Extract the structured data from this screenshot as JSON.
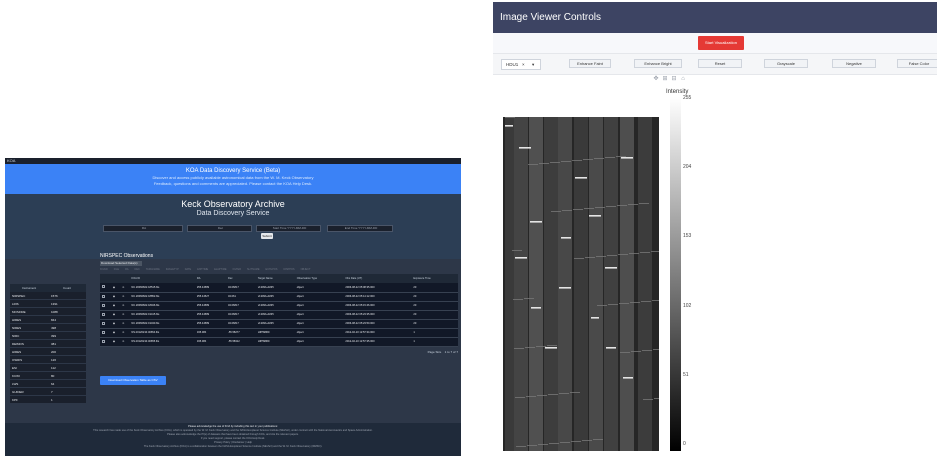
{
  "koa": {
    "topbar": "KOA",
    "banner": {
      "title": "KOA Data Discovery Service (Beta)",
      "line1": "Discover and access publicly available astronomical data from the W. M. Keck Observatory",
      "line2": "Feedback, questions and comments are appreciated. Please contact the KOA Help Desk."
    },
    "hero": {
      "title": "Keck Observatory Archive",
      "subtitle": "Data Discovery Service"
    },
    "inputs": [
      "RA",
      "Dec",
      "Start Time YYYY-MM-DD",
      "End Time YYYY-MM-DD"
    ],
    "submit": "Submit",
    "instruments": {
      "headers": [
        "Instrument",
        "Count"
      ],
      "rows": [
        [
          "NIRSPEC",
          "1576"
        ],
        [
          "LRIS",
          "1391"
        ],
        [
          "MOSFIRE",
          "1088"
        ],
        [
          "HIRES",
          "844"
        ],
        [
          "NIRES",
          "498"
        ],
        [
          "NIRC",
          "399"
        ],
        [
          "DEIMOS",
          "381"
        ],
        [
          "HIRES",
          "200"
        ],
        [
          "OSIRIS",
          "126"
        ],
        [
          "ESI",
          "112"
        ],
        [
          "KCWI",
          "80"
        ],
        [
          "LWS",
          "64"
        ],
        [
          "GUIDER",
          "7"
        ],
        [
          "KPF",
          "1"
        ]
      ]
    },
    "obs": {
      "title": "NIRSPEC Observations",
      "download_selected": "Download Selected Data(s)",
      "col_strip": [
        "KOAID",
        "FILE",
        "RA",
        "DEC",
        "TARGNAME",
        "IMAGETYP",
        "DATE",
        "EXPTIME",
        "ELAPTIME",
        "FILTER",
        "SLITNAME",
        "ECHLPOS",
        "DISPPOS",
        "OBJECT"
      ],
      "headers": [
        "",
        "",
        "",
        "KOA ID",
        "RA",
        "Dec",
        "Target Name",
        "Observation Type",
        "Obs Date (UT)",
        "Exposure Time",
        ""
      ],
      "rows": [
        [
          "",
          "",
          "",
          "NC.20060822.18515.fits",
          "255.44589",
          "43.06817",
          "v1309b+0235",
          "object",
          "2006-08-22 05:08:35.000",
          "20",
          ""
        ],
        [
          "",
          "",
          "",
          "NC.20060822.18852.fits",
          "255.44527",
          "43.061",
          "v1309b+0235",
          "object",
          "2006-08-22 05:14:12.000",
          "20",
          ""
        ],
        [
          "",
          "",
          "",
          "NC.20060822.18946.fits",
          "255.44589",
          "43.06817",
          "v1309b+0235",
          "object",
          "2006-08-22 05:15:46.000",
          "20",
          ""
        ],
        [
          "",
          "",
          "",
          "NC.20060822.19415.fits",
          "255.44589",
          "43.06817",
          "v1309b+0235",
          "object",
          "2006-08-22 05:23:35.000",
          "20",
          ""
        ],
        [
          "",
          "",
          "",
          "NC.20060822.19430.fits",
          "255.44589",
          "43.06817",
          "v1309b+0235",
          "object",
          "2006-08-22 05:23:50.000",
          "20",
          ""
        ],
        [
          "",
          "",
          "",
          "NS.20120210.46654.fits",
          "195.084",
          "-55.58277",
          "HIP59869",
          "object",
          "2012-02-10 12:57:34.000",
          "1",
          ""
        ],
        [
          "",
          "",
          "",
          "NS.20120210.46655.fits",
          "195.084",
          "-55.58312",
          "HIP59869",
          "object",
          "2012-02-10 12:57:35.000",
          "1",
          ""
        ]
      ],
      "page": "Page Size",
      "page_info": "1 to 7 of 7"
    },
    "download_csv": "Download Observation Table as CSV",
    "footer": {
      "bold": "Please acknowledge the use of KOA by including this text in your publications:",
      "line1": "This research has made use of the Keck Observatory Archive (KOA), which is operated by the W. M. Keck Observatory and the NASA Exoplanet Science Institute (NExScI), under contract with the National Aeronautics and Space Administration.",
      "line2": "Please also acknowledge the PI(s) of datasets that have been obtained through KOA, and cite the relevant papers.",
      "line3": "If you need support, please contact the KOA Help Desk.",
      "line4": "Privacy Policy  |  Disclaimer  |  Help",
      "line5": "The Keck Observatory Archive (KOA) is a collaboration between the NASA Exoplanet Science Institute (NExScI) and the W. M. Keck Observatory (WMKO)."
    }
  },
  "ivc": {
    "title": "Image Viewer Controls",
    "start": "Start Visualization",
    "hdu": {
      "value": "HDU1",
      "clear": "×",
      "dropdown": "▾"
    },
    "controls": [
      "Enhance Faint",
      "Enhance Bright",
      "Reset",
      "Grayscale",
      "Negative",
      "False Color"
    ],
    "toolbar_icons": [
      "move-icon",
      "zoom-in-icon",
      "zoom-out-icon",
      "home-icon"
    ],
    "colorbar": {
      "title": "Intensity",
      "ticks": [
        "255",
        "204",
        "153",
        "102",
        "51",
        "0"
      ]
    },
    "colors": {
      "header": "#3d4463",
      "start": "#e53935"
    }
  }
}
